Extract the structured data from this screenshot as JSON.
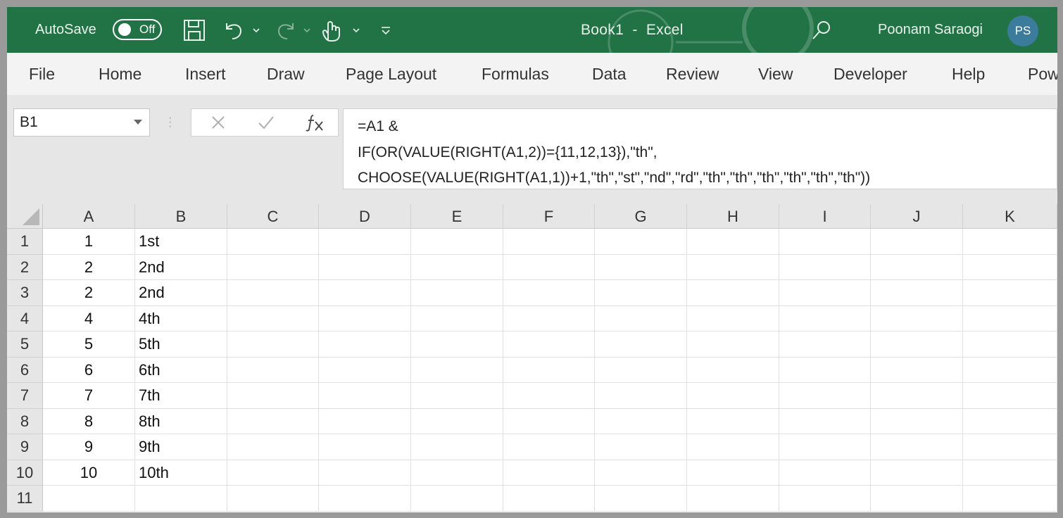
{
  "titlebar": {
    "autosave_label": "AutoSave",
    "autosave_state": "Off",
    "document_title": "Book1  -  Excel",
    "user_name": "Poonam Saraogi",
    "user_initials": "PS",
    "icons": [
      "save-icon",
      "undo-icon",
      "redo-icon",
      "touch-mode-icon",
      "customize-qat-icon",
      "search-icon"
    ]
  },
  "ribbon": {
    "tabs": [
      "File",
      "Home",
      "Insert",
      "Draw",
      "Page Layout",
      "Formulas",
      "Data",
      "Review",
      "View",
      "Developer",
      "Help",
      "Pow"
    ]
  },
  "formula_bar": {
    "name_box": "B1",
    "lines": [
      "=A1 &",
      "IF(OR(VALUE(RIGHT(A1,2))={11,12,13}),\"th\",",
      "CHOOSE(VALUE(RIGHT(A1,1))+1,\"th\",\"st\",\"nd\",\"rd\",\"th\",\"th\",\"th\",\"th\",\"th\",\"th\"))"
    ],
    "icons": [
      "cancel-icon",
      "enter-icon",
      "insert-function-icon"
    ]
  },
  "sheet": {
    "columns": [
      "A",
      "B",
      "C",
      "D",
      "E",
      "F",
      "G",
      "H",
      "I",
      "J",
      "K"
    ],
    "rows": [
      {
        "num": "1",
        "a": "1",
        "b": "1st"
      },
      {
        "num": "2",
        "a": "2",
        "b": "2nd"
      },
      {
        "num": "3",
        "a": "2",
        "b": "2nd"
      },
      {
        "num": "4",
        "a": "4",
        "b": "4th"
      },
      {
        "num": "5",
        "a": "5",
        "b": "5th"
      },
      {
        "num": "6",
        "a": "6",
        "b": "6th"
      },
      {
        "num": "7",
        "a": "7",
        "b": "7th"
      },
      {
        "num": "8",
        "a": "8",
        "b": "8th"
      },
      {
        "num": "9",
        "a": "9",
        "b": "9th"
      },
      {
        "num": "10",
        "a": "10",
        "b": "10th"
      },
      {
        "num": "11",
        "a": "",
        "b": ""
      }
    ]
  },
  "colors": {
    "title_bar": "#217346",
    "avatar": "#3b7c9c"
  }
}
